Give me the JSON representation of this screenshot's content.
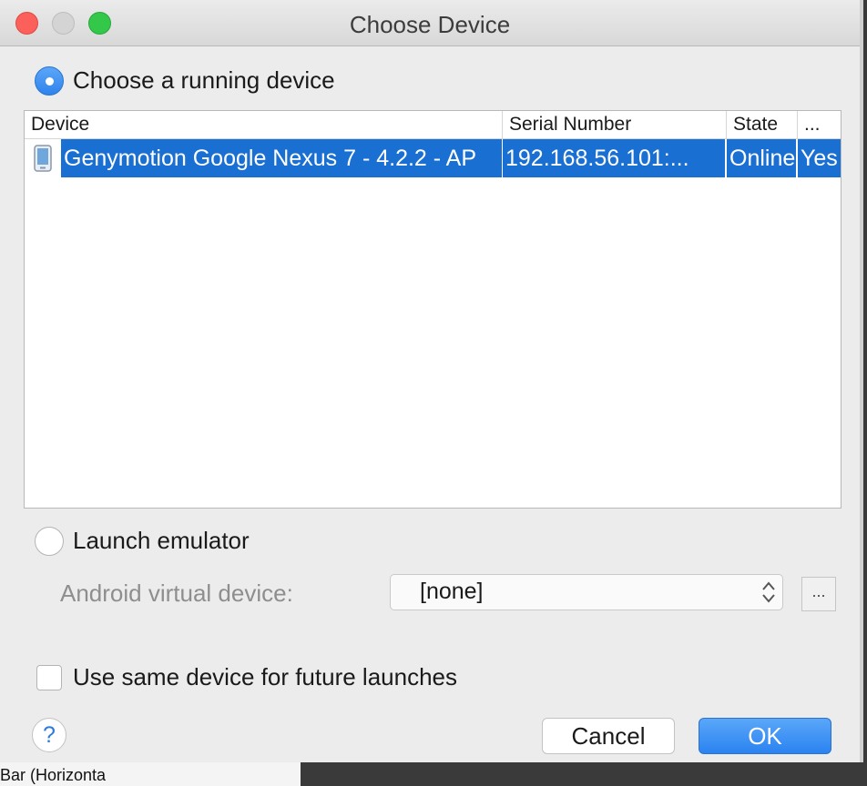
{
  "window": {
    "title": "Choose Device"
  },
  "running": {
    "label": "Choose a running device",
    "selected": true
  },
  "table": {
    "columns": [
      "Device",
      "Serial Number",
      "State",
      "..."
    ],
    "rows": [
      {
        "device": "Genymotion Google Nexus 7 - 4.2.2 - AP",
        "serial": "192.168.56.101:...",
        "state": "Online",
        "extra": "Yes",
        "selected": true
      }
    ]
  },
  "emulator": {
    "label": "Launch emulator",
    "selected": false,
    "avd_label": "Android virtual device:",
    "avd_value": "[none]",
    "browse_label": "..."
  },
  "same_device": {
    "label": "Use same device for future launches",
    "checked": false
  },
  "footer": {
    "help_label": "?",
    "cancel_label": "Cancel",
    "ok_label": "OK"
  },
  "background": {
    "text": "Bar (Horizonta"
  },
  "colors": {
    "accent": "#2b83f0",
    "selection": "#1a6fd3",
    "close": "#fc605b",
    "maximize": "#34c84a"
  },
  "icons": {
    "device_row": "phone-icon",
    "select_arrows": "updown-chevron-icon",
    "help": "help-icon"
  }
}
